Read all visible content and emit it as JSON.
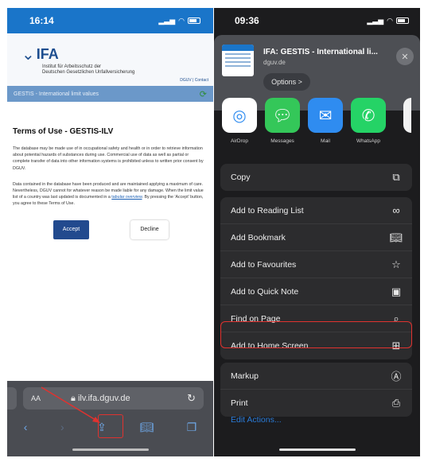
{
  "left": {
    "status_time": "16:14",
    "logo_text": "IFA",
    "institute_line1": "Institut für Arbeitsschutz der",
    "institute_line2": "Deutschen Gesetzlichen Unfallversicherung",
    "dguv_link": "DGUV | Contact",
    "bar_title": "GESTIS - International limit values",
    "terms_title": "Terms of Use - GESTIS-ILV",
    "para1": "The database may be made use of in occupational safety and health or in order to retrieve information about potential hazards of substances during use. Commercial use of data as well as partial or complete transfer of data into other information systems is prohibited unless to written prior consent by DGUV.",
    "para2_part1": "Data contained in the database have been produced and are maintained applying a maximum of care. Nevertheless, DGUV cannot for whatever reason be made liable for any damage. When the limit value list of a country was last updated is documented in a ",
    "para2_link": "tabular overview",
    "para2_part2": ". By pressing the 'Accept' button, you agree to these Terms of Use.",
    "accept_label": "Accept",
    "decline_label": "Decline",
    "aa_label": "AA",
    "url": "ilv.ifa.dguv.de"
  },
  "right": {
    "status_time": "09:36",
    "share_title": "IFA: GESTIS - International li...",
    "share_subtitle": "dguv.de",
    "options_label": "Options >",
    "apps": [
      {
        "label": "AirDrop",
        "icon": "airdrop-icon",
        "color": "#ffffff"
      },
      {
        "label": "Messages",
        "icon": "messages-icon",
        "color": "#34c759"
      },
      {
        "label": "Mail",
        "icon": "mail-icon",
        "color": "#2f8cf0"
      },
      {
        "label": "WhatsApp",
        "icon": "whatsapp-icon",
        "color": "#25d366"
      }
    ],
    "actions": {
      "copy": "Copy",
      "reading_list": "Add to Reading List",
      "bookmark": "Add Bookmark",
      "favourites": "Add to Favourites",
      "quick_note": "Add to Quick Note",
      "find_on_page": "Find on Page",
      "home_screen": "Add to Home Screen",
      "markup": "Markup",
      "print": "Print"
    },
    "edit_actions": "Edit Actions..."
  },
  "colors": {
    "highlight": "#e0322f",
    "ifa_blue": "#1a75c9",
    "sheet_bg": "#1c1c1e",
    "link_blue": "#2a7bd8"
  }
}
